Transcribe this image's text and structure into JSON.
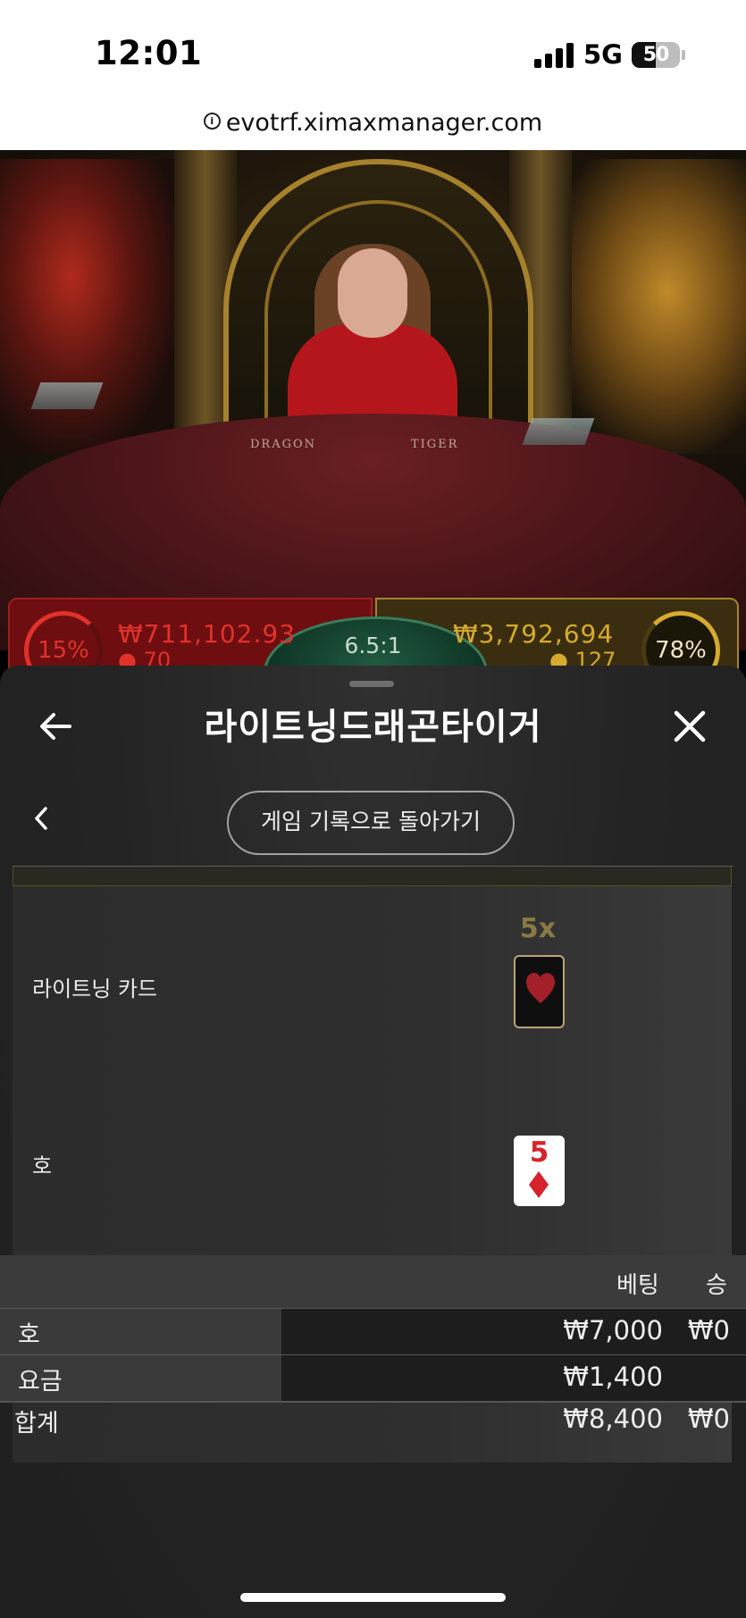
{
  "status_bar": {
    "time": "12:01",
    "network": "5G",
    "battery_percent": 50,
    "battery_label": "50"
  },
  "browser": {
    "url": "evotrf.ximaxmanager.com"
  },
  "video": {
    "table_left_label": "DRAGON",
    "table_right_label": "TIGER"
  },
  "bet_panel": {
    "dragon": {
      "percent": "15%",
      "amount": "₩711,102.93",
      "players": "70",
      "color": "#e0322b"
    },
    "tie": {
      "odds": "6.5:1"
    },
    "tiger": {
      "percent": "78%",
      "amount": "₩3,792,694",
      "players": "127",
      "color": "#d6ab2e"
    }
  },
  "sheet": {
    "title": "라이트닝드래곤타이거",
    "return_button": "게임 기록으로 돌아가기",
    "lightning": {
      "label": "라이트닝 카드",
      "multiplier": "5x",
      "suit": "heart"
    },
    "result": {
      "label": "호",
      "card_rank": "5",
      "card_suit": "diamond"
    },
    "bets": {
      "headers": {
        "bet": "베팅",
        "win": "승"
      },
      "rows": [
        {
          "name": "호",
          "bet": "₩7,000",
          "win": "₩0"
        },
        {
          "name": "요금",
          "bet": "₩1,400",
          "win": ""
        }
      ],
      "total": {
        "name": "합계",
        "bet": "₩8,400",
        "win": "₩0"
      }
    }
  }
}
